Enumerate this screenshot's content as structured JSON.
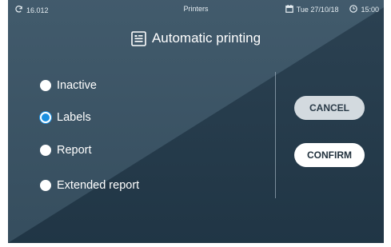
{
  "statusbar": {
    "sync_value": "16.012",
    "title": "Printers",
    "date": "Tue 27/10/18",
    "time": "15:00"
  },
  "dialog": {
    "title": "Automatic printing",
    "options": [
      {
        "label": "Inactive",
        "selected": false
      },
      {
        "label": "Labels",
        "selected": true
      },
      {
        "label": "Report",
        "selected": false
      },
      {
        "label": "Extended report",
        "selected": false
      }
    ],
    "cancel_label": "CANCEL",
    "confirm_label": "CONFIRM"
  },
  "colors": {
    "background_dark": "#233a4b",
    "background_light": "#3a5466",
    "radio_selected": "#1a8fe0",
    "cancel_button": "#d3dadf",
    "confirm_button": "#ffffff"
  },
  "icons": [
    "sync-icon",
    "calendar-icon",
    "clock-icon",
    "printer-document-icon"
  ]
}
